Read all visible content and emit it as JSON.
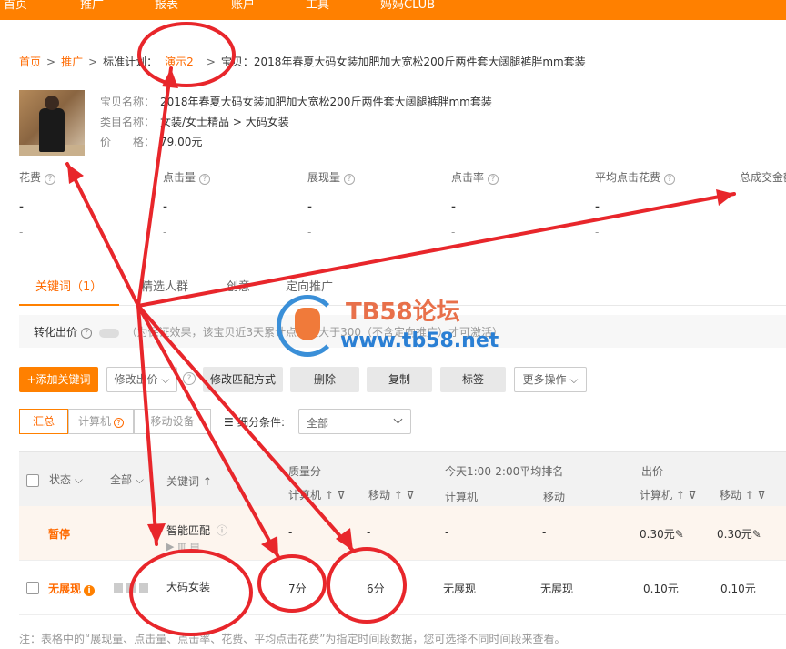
{
  "topnav": {
    "items": [
      "首页",
      "推广",
      "报表",
      "账户",
      "工具",
      "妈妈CLUB"
    ]
  },
  "breadcrumb": {
    "home": "首页",
    "promo": "推广",
    "plan_label": "标准计划：",
    "plan_name": "演示2",
    "item_label": "宝贝：",
    "item_name": "2018年春夏大码女装加肥加大宽松200斤两件套大阔腿裤胖mm套装"
  },
  "product": {
    "name_label": "宝贝名称：",
    "name": "2018年春夏大码女装加肥加大宽松200斤两件套大阔腿裤胖mm套装",
    "category_label": "类目名称：",
    "category": "女装/女士精品 > 大码女装",
    "price_label": "价　　格：",
    "price": "79.00元"
  },
  "metrics": [
    {
      "label": "花费",
      "value": "-",
      "sub": "-"
    },
    {
      "label": "点击量",
      "value": "-",
      "sub": "-"
    },
    {
      "label": "展现量",
      "value": "-",
      "sub": "-"
    },
    {
      "label": "点击率",
      "value": "-",
      "sub": "-"
    },
    {
      "label": "平均点击花费",
      "value": "-",
      "sub": "-"
    },
    {
      "label": "总成交金额",
      "value": "-",
      "sub": "-"
    }
  ],
  "tabs": [
    "关键词（1）",
    "精选人群",
    "创意",
    "定向推广"
  ],
  "conversion": {
    "label": "转化出价",
    "note": "（为保证效果，该宝贝近3天累计点击量大于300（不含定向推广）才可激活）"
  },
  "toolbar": {
    "add": "+添加关键词",
    "modify_bid": "修改出价",
    "modify_match": "修改匹配方式",
    "delete": "删除",
    "copy": "复制",
    "tag": "标签",
    "more": "更多操作"
  },
  "segments": [
    "汇总",
    "计算机",
    "移动设备"
  ],
  "filter": {
    "label": "细分条件:",
    "value": "全部"
  },
  "table": {
    "headers": {
      "status": "状态",
      "all": "全部",
      "keyword": "关键词",
      "quality": "质量分",
      "pc": "计算机",
      "mobile": "移动",
      "rank_group": "今天1:00-2:00平均排名",
      "rank_pc": "计算机",
      "rank_mobile": "移动",
      "bid_group": "出价",
      "bid_pc": "计算机",
      "bid_mobile": "移动"
    },
    "rows": [
      {
        "status": "暂停",
        "keyword": "智能匹配",
        "q_pc": "-",
        "q_mobile": "-",
        "r_pc": "-",
        "r_mobile": "-",
        "b_pc": "0.30元",
        "b_mobile": "0.30元"
      },
      {
        "status": "无展现",
        "keyword": "大码女装",
        "q_pc": "7分",
        "q_mobile": "6分",
        "r_pc": "无展现",
        "r_mobile": "无展现",
        "b_pc": "0.10元",
        "b_mobile": "0.10元"
      }
    ]
  },
  "footnote": "注：表格中的“展现量、点击量、点击率、花费、平均点击花费”为指定时间段数据，您可选择不同时间段来查看。",
  "watermark": {
    "title": "TB58论坛",
    "url": "www.tb58.net"
  },
  "colors": {
    "accent": "#ff8000",
    "link": "#ff6a00",
    "annotation": "#e8262b"
  }
}
